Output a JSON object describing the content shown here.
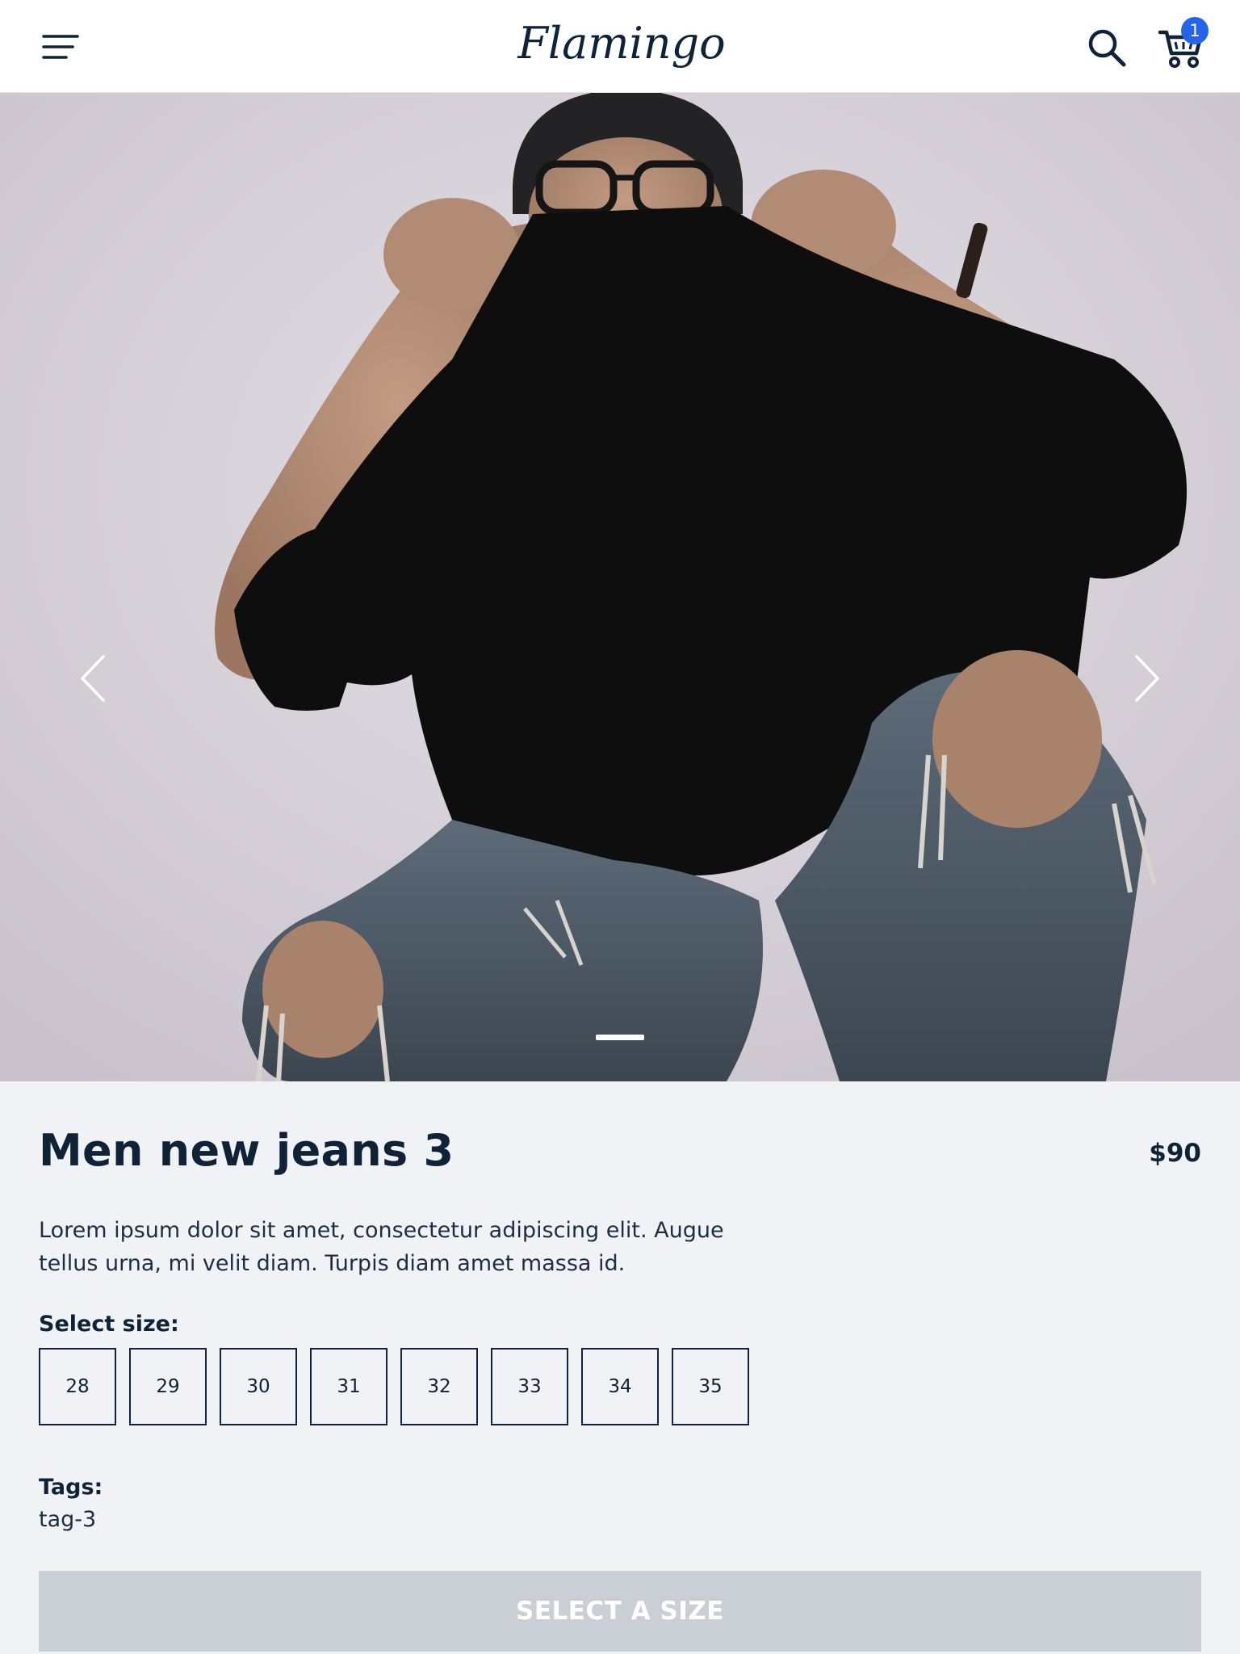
{
  "header": {
    "logo_text": "Flamingo",
    "cart_count": "1"
  },
  "hero": {
    "slide_count": 1,
    "active_slide": 1
  },
  "product": {
    "title": "Men new jeans 3",
    "price": "$90",
    "description": "Lorem ipsum dolor sit amet, consectetur adipiscing elit. Augue tellus urna, mi velit diam. Turpis diam amet massa id.",
    "size_label": "Select size:",
    "sizes": [
      "28",
      "29",
      "30",
      "31",
      "32",
      "33",
      "34",
      "35"
    ],
    "tags_label": "Tags:",
    "tags": [
      "tag-3"
    ],
    "cta_label": "SELECT A SIZE"
  },
  "colors": {
    "primary_text": "#0f2238",
    "badge": "#2563eb",
    "cta_disabled": "#c9cfd4",
    "page_bg": "#f1f2f5"
  },
  "icons": [
    "menu-icon",
    "search-icon",
    "cart-icon",
    "chevron-left-icon",
    "chevron-right-icon"
  ]
}
